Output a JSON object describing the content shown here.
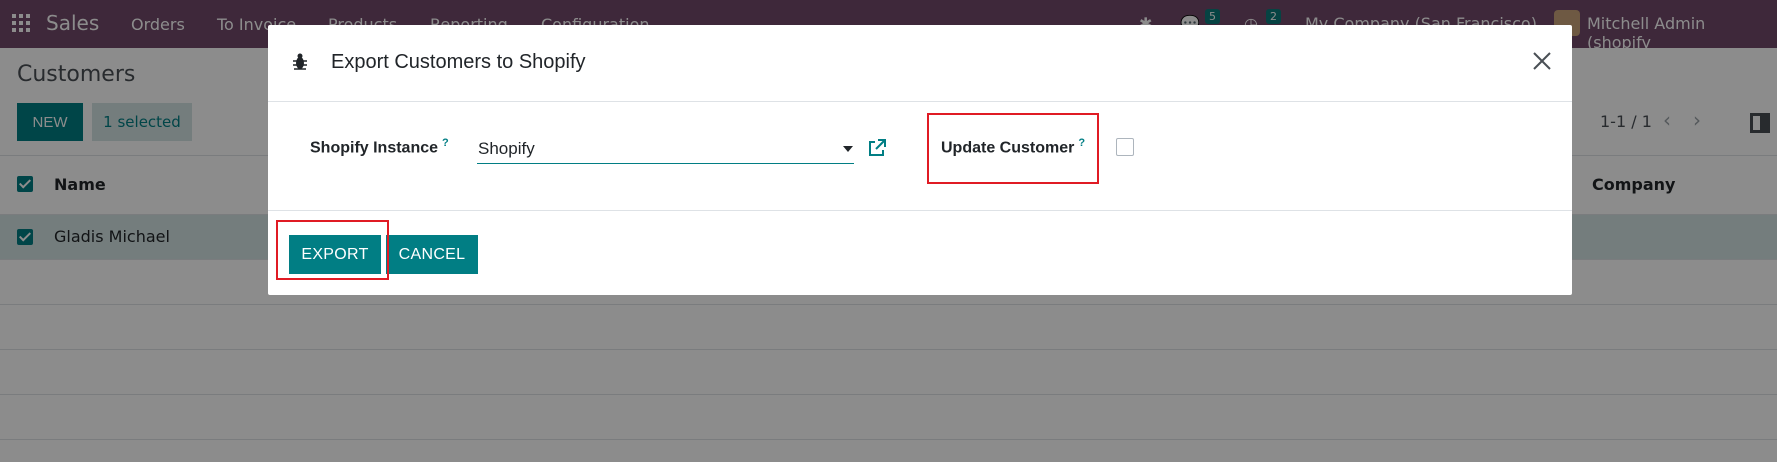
{
  "navbar": {
    "app_name": "Sales",
    "menu": [
      "Orders",
      "To Invoice",
      "Products",
      "Reporting",
      "Configuration"
    ],
    "messages_count": "5",
    "activities_count": "2",
    "company": "My Company (San Francisco)",
    "user": "Mitchell Admin (shopify_"
  },
  "control_panel": {
    "title": "Customers",
    "new_label": "NEW",
    "selected_label": "1 selected",
    "pager": "1-1 / 1"
  },
  "list": {
    "columns": [
      "Name",
      "Company"
    ],
    "rows": [
      {
        "name": "Gladis Michael",
        "selected": true
      }
    ]
  },
  "dialog": {
    "title": "Export Customers to Shopify",
    "instance_label": "Shopify Instance",
    "help_mark": "?",
    "instance_value": "Shopify",
    "update_label": "Update Customer",
    "update_checked": false,
    "export_label": "EXPORT",
    "cancel_label": "CANCEL"
  },
  "colors": {
    "navbar": "#71496a",
    "primary": "#017e84",
    "highlight": "#e01b24"
  }
}
